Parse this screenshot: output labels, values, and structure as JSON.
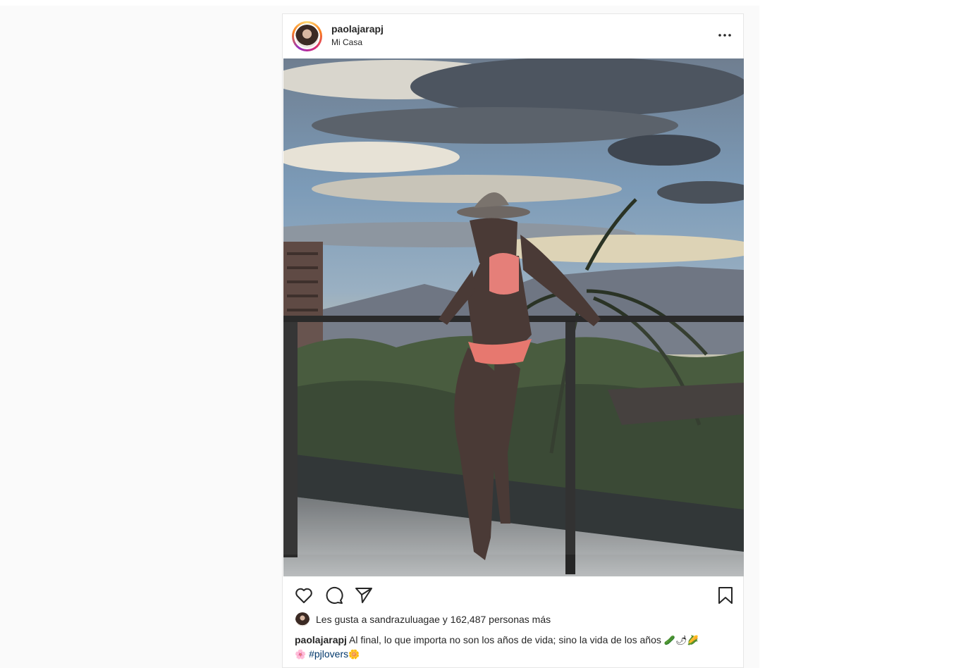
{
  "post": {
    "username": "paolajarapj",
    "location": "Mi Casa",
    "likes_text": "Les gusta a sandrazuluagae y 162,487 personas más",
    "caption_user": "paolajarapj",
    "caption_text": " Al final, lo que importa no son los años de vida; sino la vida de los años ",
    "caption_emojis": "🥒🌶🌽",
    "caption_emoji_flower": "🌸",
    "hashtag": "#pjlovers",
    "caption_emoji_sun": "🌼"
  },
  "icons": {
    "more": "more-options-icon",
    "like": "heart-icon",
    "comment": "comment-icon",
    "share": "paper-plane-icon",
    "save": "bookmark-icon"
  },
  "colors": {
    "text": "#262626",
    "hashtag": "#00376b",
    "border": "#e6e6e6",
    "background": "#fafafa"
  }
}
